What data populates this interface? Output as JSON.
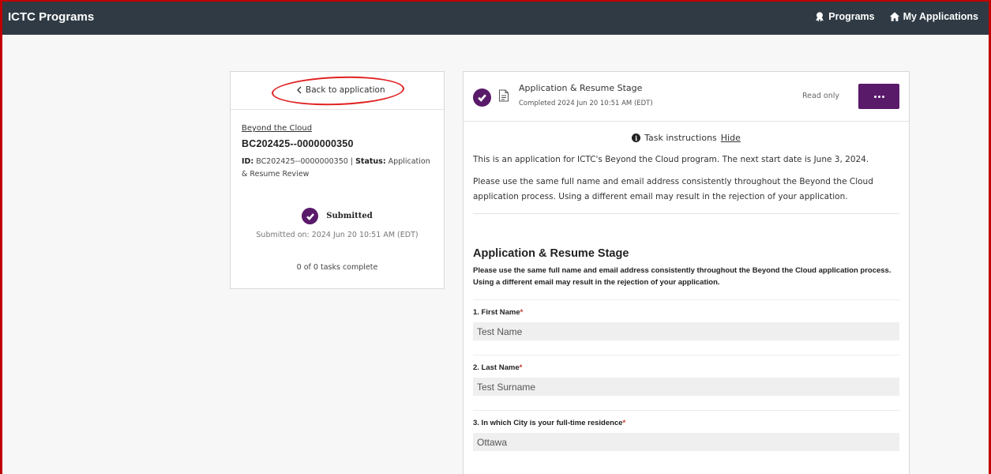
{
  "header": {
    "brand": "ICTC Programs",
    "nav": [
      {
        "label": "Programs",
        "icon": "award-icon"
      },
      {
        "label": "My Applications",
        "icon": "home-icon"
      }
    ]
  },
  "sidebar": {
    "back_label": "Back to application",
    "program_link": "Beyond the Cloud",
    "app_id": "BC202425--0000000350",
    "id_label": "ID:",
    "id_value": "BC202425--0000000350",
    "separator": "|",
    "status_label": "Status:",
    "status_value": "Application & Resume Review",
    "submitted_label": "Submitted",
    "submitted_on": "Submitted on: 2024 Jun 20 10:51 AM (EDT)",
    "tasks": "0 of 0 tasks complete"
  },
  "stage": {
    "title": "Application & Resume Stage",
    "completed": "Completed 2024 Jun 20 10:51 AM (EDT)",
    "read_only": "Read only",
    "instructions_label": "Task instructions",
    "hide_label": "Hide",
    "para1": "This is an application for ICTC's Beyond the Cloud program. The next start date is June 3, 2024.",
    "para2": "Please use the same full name and email address consistently throughout the Beyond the Cloud application process. Using a different email may result in the rejection of your application."
  },
  "form": {
    "title": "Application & Resume Stage",
    "description": "Please use the same full name and email address consistently throughout the Beyond the Cloud application process. Using a different email may result in the rejection of your application.",
    "questions": [
      {
        "label": "1. First Name",
        "required": "*",
        "value": "Test Name"
      },
      {
        "label": "2. Last Name",
        "required": "*",
        "value": "Test Surname"
      },
      {
        "label": "3. In which City is your full-time residence",
        "required": "*",
        "value": "Ottawa"
      }
    ]
  },
  "colors": {
    "topbar": "#2f3a44",
    "accent": "#5a1a6a",
    "annotation": "#e02020"
  }
}
